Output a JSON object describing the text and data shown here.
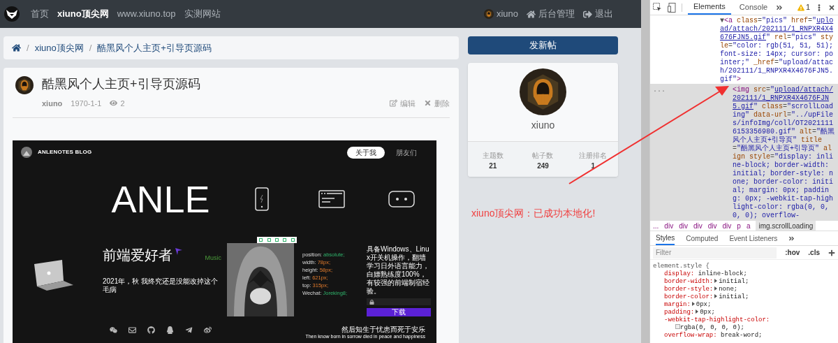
{
  "nav": {
    "links": [
      {
        "label": "首页",
        "selected": false
      },
      {
        "label": "xiuno顶尖网",
        "selected": true
      },
      {
        "label": "www.xiuno.top",
        "selected": false
      },
      {
        "label": "实测网站",
        "selected": false
      }
    ],
    "user": "xiuno",
    "admin": "后台管理",
    "logout": "退出"
  },
  "breadcrumb": [
    {
      "kind": "separator",
      "text": "/"
    },
    {
      "kind": "link",
      "text": "xiuno顶尖网"
    },
    {
      "kind": "separator",
      "text": "/"
    },
    {
      "kind": "link",
      "text": "酷黑风个人主页+引导页源码"
    }
  ],
  "post": {
    "title": "酷黑风个人主页+引导页源码",
    "author": "xiuno",
    "date": "1970-1-1",
    "views": "2",
    "edit": "编辑",
    "delete": "删除",
    "embedded_page": {
      "brand": "ANLENOTES BLOG",
      "tabs": [
        {
          "label": "关于我",
          "selected": true
        },
        {
          "label": "朋友们",
          "selected": false
        }
      ],
      "hero": "ANLE",
      "subtitle": "前端爱好者",
      "music": "Music",
      "year_line": "2021年，秋 我终究还是没能改掉这个毛病",
      "css_lines": [
        {
          "prop": "position:",
          "value": "absolute;",
          "kind": "keyword"
        },
        {
          "prop": "width:",
          "value": "78px;",
          "kind": "length"
        },
        {
          "prop": "height:",
          "value": "58px;",
          "kind": "length"
        },
        {
          "prop": "left:",
          "value": "621px;",
          "kind": "length"
        },
        {
          "prop": "top:",
          "value": "315px;",
          "kind": "length"
        },
        {
          "prop": "Wechat:",
          "value": "Joreking8;",
          "kind": "keyword"
        }
      ],
      "description": "具备Windows、Linux开关机操作，翻墙学习日外语言能力，白嫖熟练度100%，有较强的前端制宿经验。",
      "download": "下载",
      "quote": "然后知生于忧患而死于安乐",
      "quote_en": "Then know born in sorrow died in peace and happiness"
    }
  },
  "sidebar": {
    "new_post": "发新帖",
    "username": "xiuno",
    "stats": [
      {
        "label": "主题数",
        "value": "21"
      },
      {
        "label": "帖子数",
        "value": "249"
      },
      {
        "label": "注册排名",
        "value": "1"
      }
    ]
  },
  "annotation": "xiuno顶尖网：已成功本地化!",
  "devtools": {
    "tabs": [
      {
        "label": "Elements",
        "selected": true
      },
      {
        "label": "Console",
        "selected": false
      }
    ],
    "warnings": "1",
    "nodes": [
      {
        "selected": false,
        "segments": [
          {
            "kind": "toggle",
            "text": "▼"
          },
          {
            "kind": "tag",
            "text": "<a"
          },
          {
            "kind": "attr",
            "text": " class"
          },
          {
            "kind": "punct",
            "text": "="
          },
          {
            "kind": "value",
            "text": "\"pics\""
          },
          {
            "kind": "attr",
            "text": " href"
          },
          {
            "kind": "punct",
            "text": "="
          },
          {
            "kind": "value",
            "text": "\""
          },
          {
            "kind": "link",
            "text": "upload/attach/202111/1_RNPXR4X4676FJN5.gif"
          },
          {
            "kind": "value",
            "text": "\""
          },
          {
            "kind": "attr",
            "text": " rel"
          },
          {
            "kind": "punct",
            "text": "="
          },
          {
            "kind": "value",
            "text": "\"pics\""
          },
          {
            "kind": "attr",
            "text": " style"
          },
          {
            "kind": "punct",
            "text": "="
          },
          {
            "kind": "value",
            "text": "\"color: rgb(51, 51, 51); font-size: 14px; cursor: pointer;\""
          },
          {
            "kind": "attr",
            "text": " _href"
          },
          {
            "kind": "punct",
            "text": "="
          },
          {
            "kind": "value",
            "text": "\"upload/attach/202111/1_RNPXR4X4676FJN5.gif\""
          },
          {
            "kind": "tag",
            "text": ">"
          }
        ]
      },
      {
        "selected": true,
        "actions": "...",
        "segments": [
          {
            "kind": "tag",
            "text": "<img"
          },
          {
            "kind": "attr",
            "text": " src"
          },
          {
            "kind": "punct",
            "text": "="
          },
          {
            "kind": "value",
            "text": "\""
          },
          {
            "kind": "link",
            "text": "upload/attach/202111/1_RNPXR4X4676FJN5.gif"
          },
          {
            "kind": "value",
            "text": "\""
          },
          {
            "kind": "attr",
            "text": " class"
          },
          {
            "kind": "punct",
            "text": "="
          },
          {
            "kind": "value",
            "text": "\"scrollLoading\""
          },
          {
            "kind": "attr",
            "text": " data-url"
          },
          {
            "kind": "punct",
            "text": "="
          },
          {
            "kind": "value",
            "text": "\"../upFiles/infoImg/coll/OT20211116153356980.gif\""
          },
          {
            "kind": "attr",
            "text": " alt"
          },
          {
            "kind": "punct",
            "text": "="
          },
          {
            "kind": "value",
            "text": "\"酷黑风个人主页+引导页\""
          },
          {
            "kind": "attr",
            "text": " title"
          },
          {
            "kind": "punct",
            "text": "="
          },
          {
            "kind": "value",
            "text": "\"酷黑风个人主页+引导页\""
          },
          {
            "kind": "attr",
            "text": " align"
          },
          {
            "kind": "attr",
            "text": " style"
          },
          {
            "kind": "punct",
            "text": "="
          },
          {
            "kind": "value",
            "text": "\"display: inline-block; border-width: initial; border-style: none; border-color: initial; margin: 0px; padding: 0px; -webkit-tap-highlight-color: rgba(0, 0, 0, 0); overflow-"
          }
        ]
      }
    ],
    "crumbs": [
      {
        "label": "...",
        "selected": false
      },
      {
        "label": "div",
        "selected": false
      },
      {
        "label": "div",
        "selected": false
      },
      {
        "label": "div",
        "selected": false
      },
      {
        "label": "div",
        "selected": false
      },
      {
        "label": "div",
        "selected": false
      },
      {
        "label": "p",
        "selected": false
      },
      {
        "label": "a",
        "selected": false
      },
      {
        "label": "img.scrollLoading",
        "selected": true
      }
    ],
    "style_tabs": [
      {
        "label": "Styles",
        "selected": true
      },
      {
        "label": "Computed",
        "selected": false
      },
      {
        "label": "Event Listeners",
        "selected": false
      }
    ],
    "filter_placeholder": "Filter",
    "hov": ":hov",
    "cls": ".cls",
    "rule": "element.style {",
    "props": [
      {
        "name": "display:",
        "value": "inline-block;",
        "expandable": false,
        "swatch": false
      },
      {
        "name": "border-width:",
        "value": "initial;",
        "expandable": true,
        "swatch": false
      },
      {
        "name": "border-style:",
        "value": "none;",
        "expandable": true,
        "swatch": false
      },
      {
        "name": "border-color:",
        "value": "initial;",
        "expandable": true,
        "swatch": false
      },
      {
        "name": "margin:",
        "value": "0px;",
        "expandable": true,
        "swatch": false
      },
      {
        "name": "padding:",
        "value": "0px;",
        "expandable": true,
        "swatch": false
      },
      {
        "name": "-webkit-tap-highlight-color:",
        "value": "rgba(0, 0, 0, 0);",
        "expandable": false,
        "swatch": true
      },
      {
        "name": "overflow-wrap:",
        "value": "break-word;",
        "expandable": false,
        "swatch": false
      }
    ]
  }
}
